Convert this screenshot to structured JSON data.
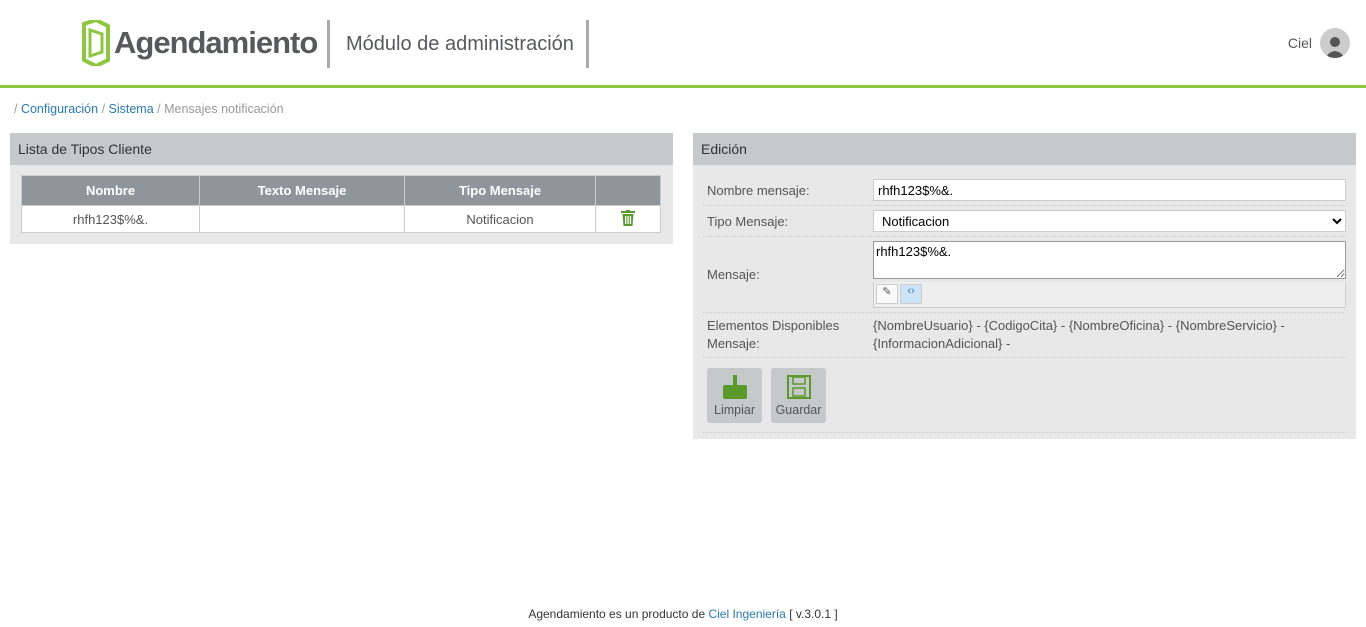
{
  "header": {
    "logo": "Agendamiento",
    "module": "Módulo de administración",
    "user": "Ciel"
  },
  "breadcrumb": {
    "items": [
      "Configuración",
      "Sistema"
    ],
    "current": "Mensajes notificación"
  },
  "list": {
    "title": "Lista de Tipos Cliente",
    "columns": [
      "Nombre",
      "Texto Mensaje",
      "Tipo Mensaje"
    ],
    "rows": [
      {
        "nombre": "rhfh123$%&.",
        "texto": "",
        "tipo": "Notificacion"
      }
    ]
  },
  "edit": {
    "title": "Edición",
    "nombre_label": "Nombre mensaje:",
    "nombre_value": "rhfh123$%&.",
    "tipo_label": "Tipo Mensaje:",
    "tipo_value": "Notificacion",
    "mensaje_label": "Mensaje:",
    "mensaje_value": "rhfh123$%&.",
    "elementos_label": "Elementos Disponibles Mensaje:",
    "elementos": "{NombreUsuario} - {CodigoCita} - {NombreOficina} - {NombreServicio} - {InformacionAdicional} -",
    "limpiar": "Limpiar",
    "guardar": "Guardar"
  },
  "footer": {
    "pre": "Agendamiento es un producto de",
    "link": "Ciel Ingeniería",
    "version": "[ v.3.0.1 ]"
  },
  "colors": {
    "accent": "#8dc63f",
    "link": "#2a7ab0"
  }
}
